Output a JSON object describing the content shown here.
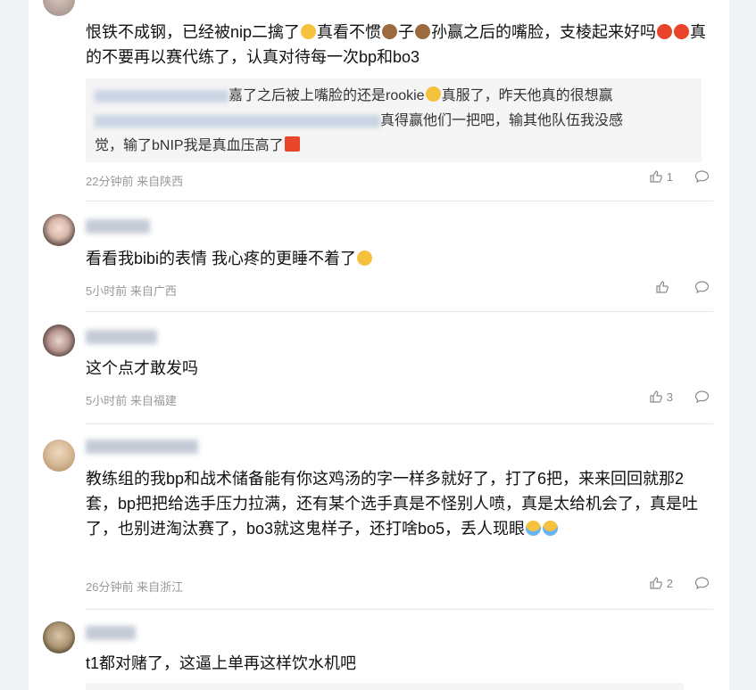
{
  "comments": [
    {
      "text": "恨铁不成钢，已经被nip二擒了",
      "text_b": "真看不惯",
      "text_c": "子",
      "text_d": "孙赢之后的嘴脸，支棱起来好吗",
      "text_e": "真的不要再以赛代练了，认真对待每一次bp和bo3",
      "quote": {
        "line1": "嘉了之后被上嘴脸的还是rookie",
        "line1b": "真服了，昨天他真的很想赢",
        "line2": "真得赢他们一把吧，输其他队伍我没感",
        "line3": "觉，输了bNIP我是真血压高了"
      },
      "time": "22分钟前 来自陕西",
      "likes": "1"
    },
    {
      "text": "看看我bibi的表情 我心疼的更睡不着了",
      "time": "5小时前 来自广西",
      "likes": ""
    },
    {
      "text": "这个点才敢发吗",
      "time": "5小时前 来自福建",
      "likes": "3"
    },
    {
      "text": "教练组的我bp和战术储备能有你这鸡汤的字一样多就好了，打了6把，来来回回就那2套，bp把把给选手压力拉满，还有某个选手真是不怪别人喷，真是太给机会了，真是吐了，也别进淘汰赛了，bo3就这鬼样子，还打啥bo5，丢人现眼",
      "time": "26分钟前 来自浙江",
      "likes": "2"
    },
    {
      "text": "t1都对赌了，这逼上单再这样饮水机吧"
    }
  ],
  "icons": {
    "like": "thumbs-up-icon",
    "comment": "comment-bubble-icon"
  }
}
